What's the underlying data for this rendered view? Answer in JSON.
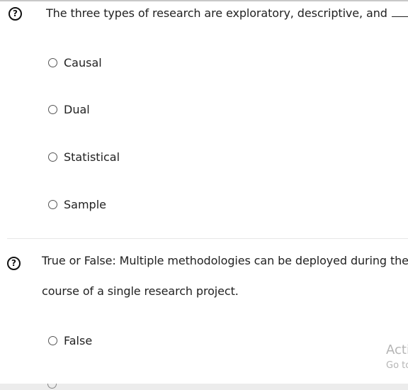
{
  "questions": [
    {
      "icon": "question-circle-icon",
      "text": "The three types of research are exploratory, descriptive, and",
      "blank_suffix": ".",
      "options": [
        "Causal",
        "Dual",
        "Statistical",
        "Sample"
      ]
    },
    {
      "icon": "question-circle-icon",
      "text_line1": "True or False: Multiple methodologies can be deployed during the",
      "text_line2": "course of a single research project.",
      "options": [
        "False"
      ]
    }
  ],
  "icon_glyph": "?",
  "watermark": {
    "line1": "Acti",
    "line2": "Go to"
  },
  "colors": {
    "text": "#222222",
    "radio_border": "#555555",
    "divider": "#e6e6e6",
    "watermark": "#b5b5b5"
  }
}
